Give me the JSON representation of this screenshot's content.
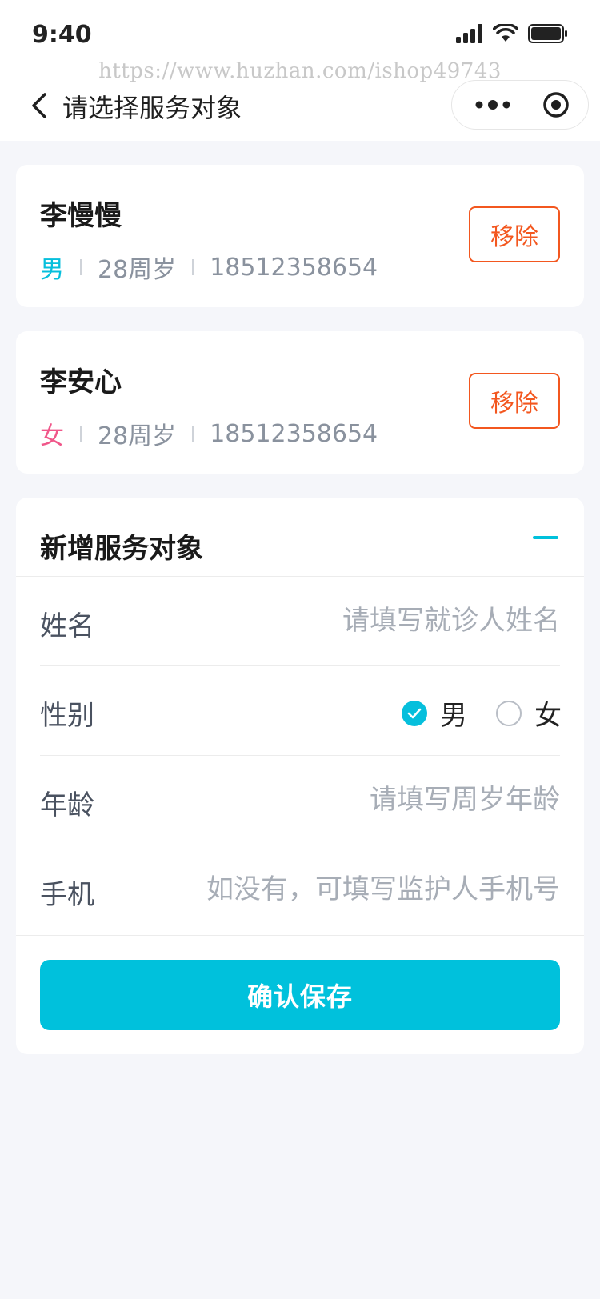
{
  "status_bar": {
    "time": "9:40"
  },
  "watermark": "https://www.huzhan.com/ishop49743",
  "nav": {
    "title": "请选择服务对象"
  },
  "patients": [
    {
      "name": "李慢慢",
      "gender": "男",
      "age": "28周岁",
      "phone": "18512358654",
      "remove_label": "移除"
    },
    {
      "name": "李安心",
      "gender": "女",
      "age": "28周岁",
      "phone": "18512358654",
      "remove_label": "移除"
    }
  ],
  "form": {
    "title": "新增服务对象",
    "name": {
      "label": "姓名",
      "placeholder": "请填写就诊人姓名",
      "value": ""
    },
    "gender": {
      "label": "性别",
      "options": [
        "男",
        "女"
      ],
      "selected": "男"
    },
    "age": {
      "label": "年龄",
      "placeholder": "请填写周岁年龄",
      "value": ""
    },
    "phone": {
      "label": "手机",
      "placeholder": "如没有，可填写监护人手机号",
      "value": ""
    },
    "save_label": "确认保存"
  },
  "colors": {
    "accent": "#00c1dc",
    "remove": "#f3571f",
    "male": "#06bfdc",
    "female": "#f0578a",
    "background": "#f5f6fa"
  }
}
